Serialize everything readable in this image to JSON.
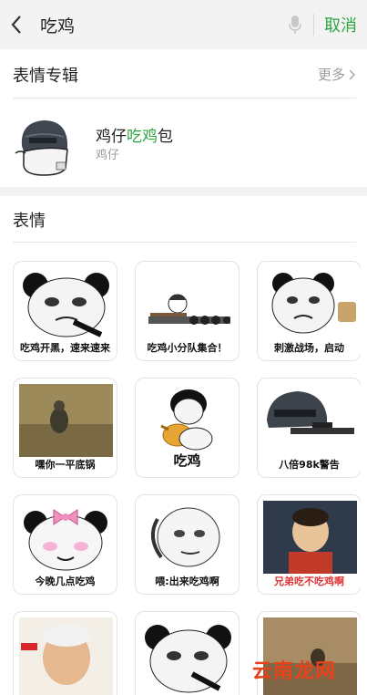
{
  "search": {
    "query": "吃鸡",
    "cancel_label": "取消"
  },
  "album_section": {
    "title": "表情专辑",
    "more_label": "更多",
    "album": {
      "title_parts": [
        "鸡",
        "仔",
        "吃鸡",
        "包"
      ],
      "subtitle": "鸡仔"
    }
  },
  "sticker_section": {
    "title": "表情",
    "stickers": [
      {
        "caption": "吃鸡开黑，速来速来"
      },
      {
        "caption": "吃鸡小分队集合！"
      },
      {
        "caption": "刺激战场，启动"
      },
      {
        "caption": "嘿你一平底锅"
      },
      {
        "caption": "吃鸡"
      },
      {
        "caption": "八倍98k警告"
      },
      {
        "caption": "今晚几点吃鸡"
      },
      {
        "caption": "喂:出来吃鸡啊"
      },
      {
        "caption": "兄弟吃不吃鸡啊"
      },
      {
        "caption": ""
      },
      {
        "caption": ""
      },
      {
        "caption": ""
      }
    ]
  },
  "watermark": "云南龙网",
  "colors": {
    "accent": "#2fa444",
    "bar_bg": "#f3f3f3"
  }
}
